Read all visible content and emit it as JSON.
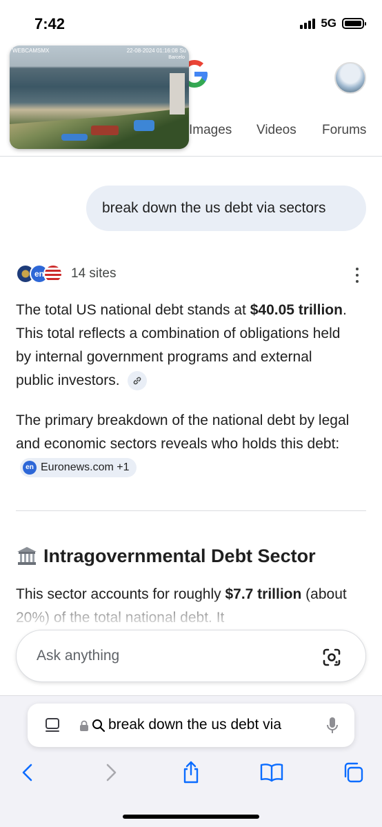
{
  "status_bar": {
    "time": "7:42",
    "network": "5G"
  },
  "header": {
    "google_logo": "G",
    "tabs": [
      "Images",
      "Videos",
      "Forums"
    ]
  },
  "pip_video": {
    "label": "WEBCAMSMX",
    "timestamp": "22-08-2024  01:16:08  Su",
    "place": "Barcelo"
  },
  "query": {
    "text": "break down the us debt via sectors"
  },
  "sources": {
    "count_label": "14 sites",
    "icons": [
      "seal-icon",
      "en-icon",
      "flag-icon"
    ]
  },
  "answer": {
    "para1": {
      "pre": "The total US national debt stands at ",
      "bold": "$40.05 trillion",
      "post": ". This total reflects a combination of obligations held by internal government programs and external public investors."
    },
    "para2": {
      "text": "The primary breakdown of the national debt by legal and economic sectors reveals who holds this debt:",
      "chip_icon": "en",
      "chip_label": "Euronews.com +1"
    },
    "section": {
      "heading": "Intragovernmental Debt Sector",
      "pre": "This sector accounts for roughly ",
      "bold": "$7.7 trillion",
      "post": " (about 20%) of the total national debt. It"
    }
  },
  "ask": {
    "placeholder": "Ask anything"
  },
  "safari": {
    "url_text": "break down the us debt via",
    "nav": [
      "back",
      "forward",
      "share",
      "bookmarks",
      "tabs"
    ]
  },
  "colors": {
    "accent": "#2d67d7",
    "link_blue": "#0a6cff",
    "bubble": "#e9eef6"
  }
}
